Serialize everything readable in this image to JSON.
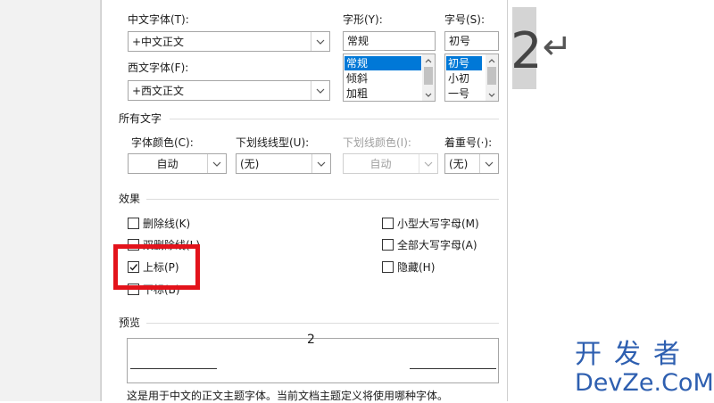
{
  "document": {
    "text": "2",
    "return_mark": "↵"
  },
  "dialog": {
    "chinese_font": {
      "label": "中文字体(T):",
      "value": "+中文正文"
    },
    "western_font": {
      "label": "西文字体(F):",
      "value": "+西文正文"
    },
    "font_style": {
      "label": "字形(Y):",
      "value": "常规",
      "options": [
        "常规",
        "倾斜",
        "加粗"
      ],
      "selected": "常规"
    },
    "font_size": {
      "label": "字号(S):",
      "value": "初号",
      "options": [
        "初号",
        "小初",
        "一号"
      ],
      "selected": "初号"
    },
    "all_text": {
      "section_title": "所有文字",
      "font_color": {
        "label": "字体颜色(C):",
        "value": "自动"
      },
      "underline_style": {
        "label": "下划线线型(U):",
        "value": "(无)"
      },
      "underline_color": {
        "label": "下划线颜色(I):",
        "value": "自动",
        "disabled": true
      },
      "emphasis_mark": {
        "label": "着重号(·):",
        "value": "(无)"
      }
    },
    "effects": {
      "section_title": "效果",
      "strikethrough": {
        "label": "删除线(K)",
        "checked": false
      },
      "double_strikethrough": {
        "label": "双删除线(L)",
        "checked": false
      },
      "superscript": {
        "label": "上标(P)",
        "checked": true
      },
      "subscript": {
        "label": "下标(B)",
        "checked": false
      },
      "small_caps": {
        "label": "小型大写字母(M)",
        "checked": false
      },
      "all_caps": {
        "label": "全部大写字母(A)",
        "checked": false
      },
      "hidden": {
        "label": "隐藏(H)",
        "checked": false
      }
    },
    "preview": {
      "section_title": "预览",
      "sample_text": "2",
      "note": "这是用于中文的正文主题字体。当前文档主题定义将使用哪种字体。"
    }
  },
  "watermark": {
    "cn": "开发者",
    "en": "DevZe.CoM"
  },
  "colors": {
    "highlight": "#e3131b",
    "selection": "#0078d7",
    "watermark": "#2e5fb0"
  }
}
